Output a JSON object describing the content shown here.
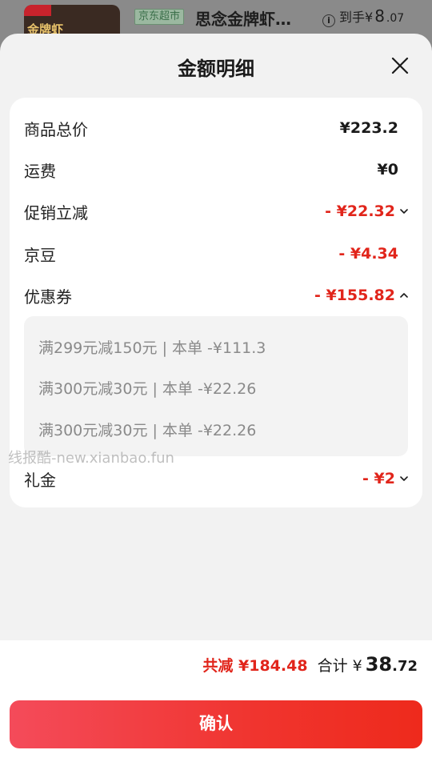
{
  "background_product": {
    "thumb_text": "金牌虾",
    "badge": "京东超市",
    "title": "思念金牌虾…",
    "price_prefix": "到手¥",
    "price_int": "8",
    "price_dec": ".07"
  },
  "sheet": {
    "title": "金额明细"
  },
  "rows": [
    {
      "label": "商品总价",
      "value": "¥223.2"
    },
    {
      "label": "运费",
      "value": "¥0"
    },
    {
      "label": "促销立减",
      "value": "- ¥22.32"
    },
    {
      "label": "京豆",
      "value": "- ¥4.34"
    },
    {
      "label": "优惠券",
      "value": "- ¥155.82"
    },
    {
      "label": "礼金",
      "value": "- ¥2"
    }
  ],
  "coupons": [
    "满299元减150元 | 本单 -¥111.3",
    "满300元减30元 | 本单 -¥22.26",
    "满300元减30元 | 本单 -¥22.26"
  ],
  "watermark": "线报酷-new.xianbao.fun",
  "footer": {
    "saved": "共减 ¥184.48",
    "total_label": "合计 ¥",
    "total_int": "38",
    "total_dec": ".72",
    "confirm_label": "确认"
  },
  "colors": {
    "accent_red": "#e1251b",
    "button_gradient_start": "#f44b5a",
    "button_gradient_end": "#ee2a1c"
  }
}
